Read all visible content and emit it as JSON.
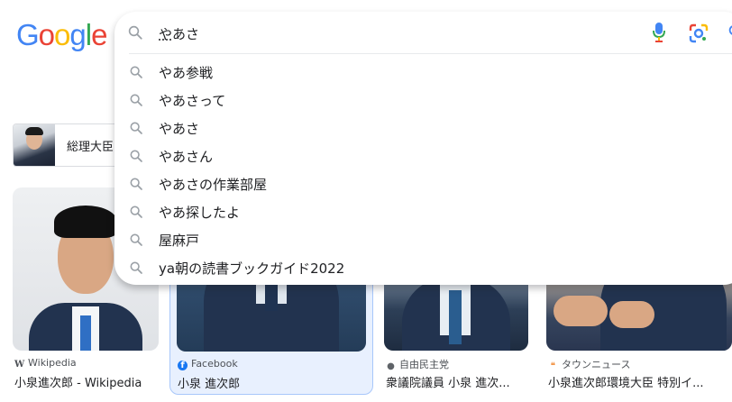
{
  "logo": {
    "text": "Google"
  },
  "search": {
    "query": "やあさ",
    "query_composing": "や",
    "query_rest": "あさ"
  },
  "suggestions": [
    {
      "text": "やあ参戦"
    },
    {
      "text": "やあさって"
    },
    {
      "text": "やあさ"
    },
    {
      "text": "やあさん"
    },
    {
      "text": "やあさの作業部屋"
    },
    {
      "text": "やあ探したよ"
    },
    {
      "text": "屋麻戸"
    },
    {
      "text": "ya朝の読書ブックガイド2022"
    }
  ],
  "chip": {
    "label": "総理大臣"
  },
  "image_results": [
    {
      "source": "Wikipedia",
      "source_icon": "W",
      "caption": "小泉進次郎 - Wikipedia"
    },
    {
      "source": "Facebook",
      "source_icon": "f",
      "caption": "小泉 進次郎"
    },
    {
      "source": "自由民主党",
      "source_icon": "globe",
      "caption": "衆議院議員 小泉 進次..."
    },
    {
      "source": "タウンニュース",
      "source_icon": "leaf",
      "caption": "小泉進次郎環境大臣 特別イ..."
    }
  ],
  "colors": {
    "google_blue": "#4285f4",
    "google_red": "#ea4335",
    "google_yellow": "#fbbc05",
    "google_green": "#34a853",
    "selected_card_border": "#a8c7fa"
  },
  "icons": {
    "search": "search-icon",
    "mic": "microphone-icon",
    "lens": "google-lens-icon"
  }
}
